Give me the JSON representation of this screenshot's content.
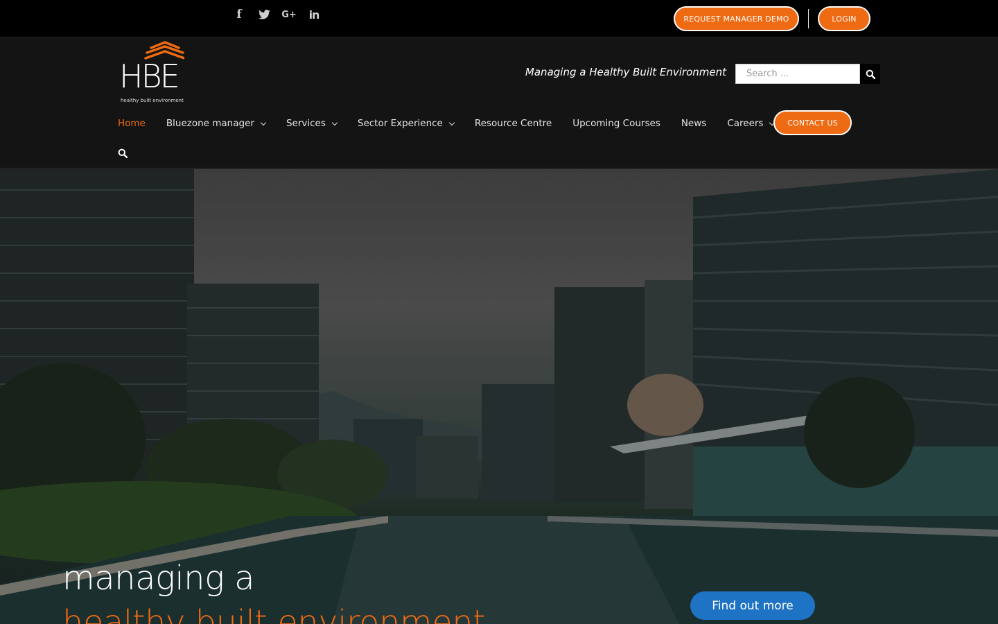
{
  "topbar": {
    "social": [
      {
        "icon": "facebook-icon",
        "glyph": "f"
      },
      {
        "icon": "twitter-icon",
        "glyph": "🐦"
      },
      {
        "icon": "google-plus-icon",
        "glyph": "G+"
      },
      {
        "icon": "linkedin-icon",
        "glyph": "in"
      }
    ],
    "demo_label": "REQUEST MANAGER DEMO",
    "login_label": "LOGIN"
  },
  "header": {
    "logo_word": "HBE",
    "logo_tagline": "healthy built environment",
    "tagline": "Managing a Healthy Built Environment",
    "search_placeholder": "Search ..."
  },
  "nav": {
    "items": [
      {
        "label": "Home",
        "active": true,
        "dropdown": false
      },
      {
        "label": "Bluezone manager",
        "active": false,
        "dropdown": true
      },
      {
        "label": "Services",
        "active": false,
        "dropdown": true
      },
      {
        "label": "Sector Experience",
        "active": false,
        "dropdown": true
      },
      {
        "label": "Resource Centre",
        "active": false,
        "dropdown": false
      },
      {
        "label": "Upcoming Courses",
        "active": false,
        "dropdown": false
      },
      {
        "label": "News",
        "active": false,
        "dropdown": false
      },
      {
        "label": "Careers",
        "active": false,
        "dropdown": true
      }
    ],
    "contact_label": "CONTACT US"
  },
  "hero": {
    "title_line1": "managing a",
    "title_line2": "healthy built environment",
    "cta_label": "Find out more"
  },
  "colors": {
    "accent": "#ee6a13",
    "cta": "#1f73c4",
    "topbar": "#000000",
    "header": "#141414"
  }
}
